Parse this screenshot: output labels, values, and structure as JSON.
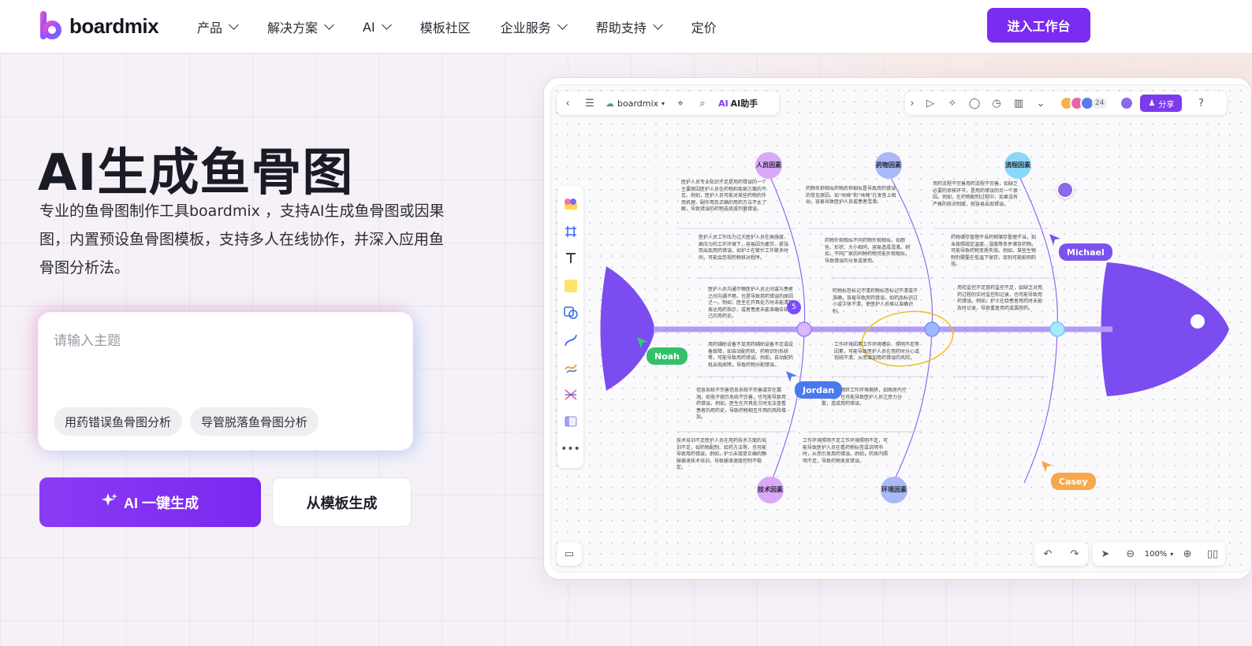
{
  "nav": {
    "brand": "boardmix",
    "items": [
      {
        "label": "产品",
        "dropdown": true
      },
      {
        "label": "解决方案",
        "dropdown": true
      },
      {
        "label": "AI",
        "dropdown": true
      },
      {
        "label": "模板社区",
        "dropdown": false
      },
      {
        "label": "企业服务",
        "dropdown": true
      },
      {
        "label": "帮助支持",
        "dropdown": true
      },
      {
        "label": "定价",
        "dropdown": false
      }
    ],
    "cta": "进入工作台"
  },
  "hero": {
    "title": "AI生成鱼骨图",
    "description": "专业的鱼骨图制作工具boardmix ，支持AI生成鱼骨图或因果图，内置预设鱼骨图模板，支持多人在线协作，并深入应用鱼骨图分析法。",
    "input_placeholder": "请输入主题",
    "chips": [
      "用药错误鱼骨图分析",
      "导管脱落鱼骨图分析"
    ],
    "ai_button": "AI 一键生成",
    "template_button": "从模板生成"
  },
  "board": {
    "brand": "boardmix",
    "ai_helper": "AI助手",
    "share": "分享",
    "collaborator_count": "24",
    "zoom": "100%",
    "badge": "5",
    "nodes": {
      "top": [
        "人员因素",
        "药物因素",
        "流程因素"
      ],
      "bottom": [
        "技术因素",
        "环境因素"
      ]
    },
    "cursors": [
      "Noah",
      "Jordan",
      "Michael",
      "Casey"
    ],
    "notes": [
      "医护人员专业知识不足是用药错误的一个主要原因医护人员在药物和疾病方面的不足。例如，医护人员可能对某些药物的作用机理、副作用及正确的用药方法不太了解，导致错误的药物选择或剂量错误。",
      "医护人员工作压力过大医护人员在高强度、高压力的工作环境下，容易因为疲劳、紧张而出现用药错误。如护士在繁忙工作繁多时间，可能会忽视药物核对程序。",
      "医护人员沟通不畅医护人员之间或与患者之间沟通不畅，也是导致用药错误的原因之一。例如，医生在开具处方时未能清楚表达用药指示，或者患者未能准确告知自己的用药史。",
      "药物名称相似药物名称相似是导致用药错误的常见原因。如“呋喃”和“呋喃”在发音上相似，容易导致医护人员或患者混淆。",
      "药物外观相似不同药物外观相似，如颜色、形状、大小相同，容易造成混淆。例如，不同厂家的同种药物可能外观相似，导致错误的分发或使用。",
      "药物标签标记不清药物标签标记不清或不准确，容易导致用药错误。如药品标识过小或字体不清，使医护人员难以准确识别。",
      "用药流程不完善用药流程不完善，如缺乏必要的审核环节，是用药错误的另一个原因。例如，在药物配制过程中，如果没有严格的核对制度，就容易出现错误。",
      "药物储存管理不当药物储存管理不当，如未按照规定温度、湿度等条件储存药物，可能导致药物变质失效。例如，某些生物制剂需要在低温下保存，否则可能影响药效。",
      "用药监控不足用药监控不足，如缺乏对用药过程的实时监控和记录，也可能导致用药错误。例如，护士在给患者用药时未能及时记录，导致重复用药或漏用药。",
      "用药辅助设备不足用药辅助设备不足或设备故障，如自动配药机、药物识别系统等，可能导致用药错误。例如，自动配药机出现故障，导致药物分配错误。",
      "信息系统不完善信息系统不完善或存在漏洞，如电子病历系统不完善，也可能导致用药错误。例如，医生在开具处方时无法查看患者的用药史，导致药物相互作用的风险增加。",
      "技术培训不足医护人员在用药技术方面的培训不足，如药物配制、给药方法等，也可能导致用药错误。例如，护士未接受正确的静脉输液技术培训，导致输液速度控制不稳定。",
      "工作环境因素工作环境嘈杂、照明不足等因素，可能导致医护人员在用药时分心或视线不清，从而增加用药错误的风险。",
      "工作环境拥挤工作环境拥挤，如病房内空间不足，也可能导致医护人员注意力分散，造成用药错误。",
      "工作环境照明不足工作环境照明不足，可能导致医护人员在看药物标签或说明书时，从而引发用药错误。例如，药房内照明不足，导致药物发放错误。"
    ]
  }
}
